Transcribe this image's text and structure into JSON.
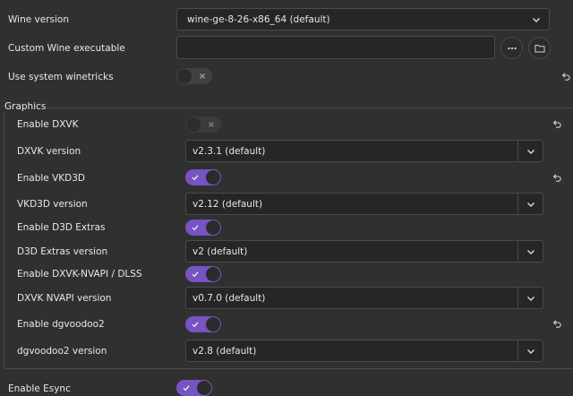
{
  "wine_version": {
    "label": "Wine version",
    "selected": "wine-ge-8-26-x86_64 (default)"
  },
  "custom_wine": {
    "label": "Custom Wine executable",
    "value": "",
    "more_button": "more-options",
    "browse_button": "folder"
  },
  "system_winetricks": {
    "label": "Use system winetricks",
    "enabled": false
  },
  "graphics": {
    "title": "Graphics",
    "enable_dxvk": {
      "label": "Enable DXVK",
      "enabled": false
    },
    "dxvk_version": {
      "label": "DXVK version",
      "selected": "v2.3.1 (default)"
    },
    "enable_vkd3d": {
      "label": "Enable VKD3D",
      "enabled": true
    },
    "vkd3d_version": {
      "label": "VKD3D version",
      "selected": "v2.12 (default)"
    },
    "enable_d3d_extras": {
      "label": "Enable D3D Extras",
      "enabled": true
    },
    "d3d_extras_version": {
      "label": "D3D Extras version",
      "selected": "v2 (default)"
    },
    "enable_dxvk_nvapi": {
      "label": "Enable DXVK-NVAPI / DLSS",
      "enabled": true
    },
    "dxvk_nvapi_version": {
      "label": "DXVK NVAPI version",
      "selected": "v0.7.0 (default)"
    },
    "enable_dgvoodoo2": {
      "label": "Enable dgvoodoo2",
      "enabled": true
    },
    "dgvoodoo2_version": {
      "label": "dgvoodoo2 version",
      "selected": "v2.8 (default)"
    }
  },
  "esync": {
    "label": "Enable Esync",
    "enabled": true
  },
  "colors": {
    "accent": "#7753c4",
    "background": "#303030",
    "field": "#262626"
  },
  "icons": {
    "dropdown": "chevron-down-icon",
    "reset": "undo-icon",
    "more": "ellipsis-icon",
    "folder": "folder-icon",
    "on": "check-icon",
    "off": "x-icon"
  }
}
